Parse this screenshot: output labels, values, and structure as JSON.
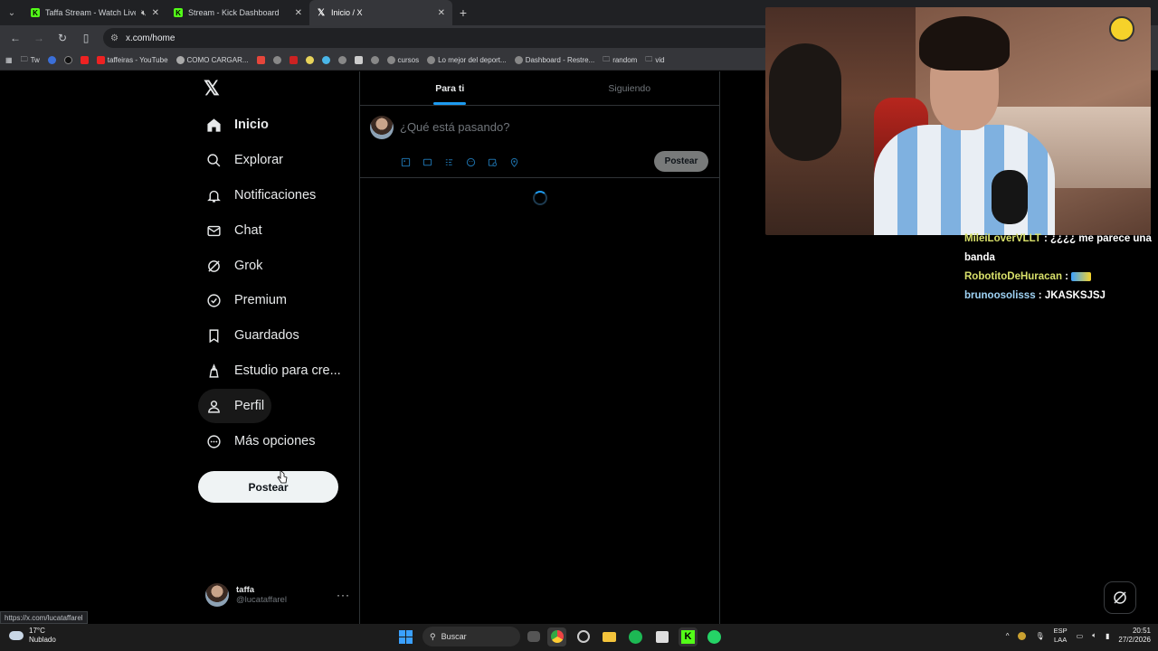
{
  "browser": {
    "tabs": [
      {
        "title": "Taffa Stream - Watch Live o",
        "icon": "kick-favicon"
      },
      {
        "title": "Stream - Kick Dashboard",
        "icon": "kick-favicon"
      },
      {
        "title": "Inicio / X",
        "icon": "x-favicon",
        "active": true
      }
    ],
    "url": "x.com/home",
    "bookmarks": [
      "Tw",
      "taffeiras - YouTube",
      "COMO CARGAR...",
      "cursos",
      "Lo mejor del deport...",
      "Dashboard - Restre...",
      "random",
      "vid"
    ]
  },
  "x": {
    "nav": [
      {
        "label": "Inicio",
        "icon": "home-icon"
      },
      {
        "label": "Explorar",
        "icon": "search-icon"
      },
      {
        "label": "Notificaciones",
        "icon": "bell-icon"
      },
      {
        "label": "Chat",
        "icon": "mail-icon"
      },
      {
        "label": "Grok",
        "icon": "grok-icon"
      },
      {
        "label": "Premium",
        "icon": "verified-icon"
      },
      {
        "label": "Guardados",
        "icon": "bookmark-icon"
      },
      {
        "label": "Estudio para cre...",
        "icon": "studio-icon"
      },
      {
        "label": "Perfil",
        "icon": "person-icon"
      },
      {
        "label": "Más opciones",
        "icon": "more-circle-icon"
      }
    ],
    "post_button": "Postear",
    "account": {
      "name": "taffa",
      "handle": "@lucataffarel"
    },
    "feed_tabs": [
      "Para ti",
      "Siguiendo"
    ],
    "composer": {
      "placeholder": "¿Qué está pasando?",
      "post_label": "Postear"
    }
  },
  "stream_chat": [
    {
      "user": "MileiLoverVLLT",
      "msg": "¿¿¿¿ me parece una banda"
    },
    {
      "user": "RobotitoDeHuracan",
      "msg": ""
    },
    {
      "user": "brunoosolisss",
      "msg": "JKASKSJSJ"
    }
  ],
  "status_url": "https://x.com/lucataffarel",
  "taskbar": {
    "weather_temp": "17°C",
    "weather_desc": "Nublado",
    "search_label": "Buscar",
    "lang_top": "ESP",
    "lang_bottom": "LAA",
    "time": "20:51",
    "date": "27/2/2026"
  },
  "colors": {
    "accent": "#1d9bf0",
    "kick": "#53fc18",
    "bg": "#000000"
  }
}
